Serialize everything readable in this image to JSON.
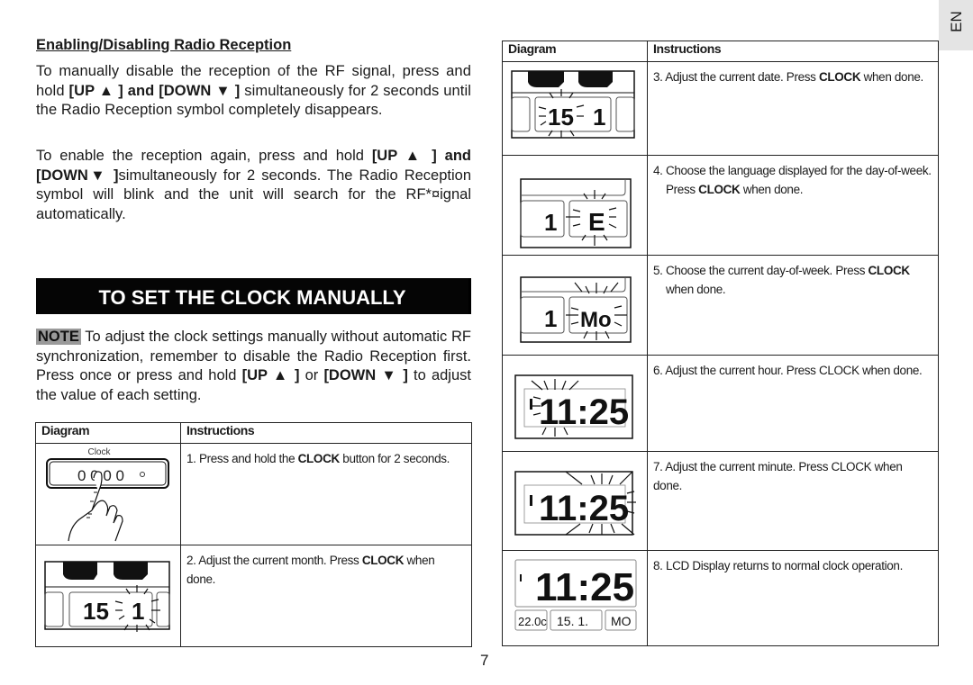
{
  "section1": {
    "heading": "Enabling/Disabling Radio Reception",
    "para1": {
      "t1": "To manually disable the reception of the RF signal, press and hold ",
      "b1": "[UP ▲ ] and [DOWN ▼ ]",
      "t2": " simultaneously for 2 seconds until the Radio Reception symbol completely disappears."
    },
    "para2": {
      "t1": "To enable the reception again, press and hold ",
      "b1": "[UP ▲ ] and [DOWN▼ ]",
      "t2": "simultaneously for 2 seconds. The Radio Reception symbol will blink and the unit will search for the RF*¤ignal automatically."
    }
  },
  "section2": {
    "title": "TO SET THE CLOCK MANUALLY",
    "note_label": "NOTE",
    "note": {
      "t1": " To adjust the clock settings manually without automatic RF synchronization, remember to disable the Radio Reception first. Press once or press and hold ",
      "b1": "[UP ▲ ]",
      "t2": " or ",
      "b2": "[DOWN ▼ ]",
      "t3": " to adjust the value of each setting."
    }
  },
  "table": {
    "col_diagram": "Diagram",
    "col_instructions": "Instructions",
    "steps": [
      {
        "pre": "1. Press and hold the ",
        "bold": "CLOCK",
        "post": " button for 2 seconds.",
        "diagram": "clock-button-press",
        "diagram_label": "Clock",
        "button_digits": "0 0 0 0"
      },
      {
        "pre": "2. Adjust the current month. Press ",
        "bold": "CLOCK",
        "post": " when done.",
        "diagram": "lcd-month-blinking",
        "lcd": "15. 1."
      },
      {
        "pre": "3. Adjust the current date. Press ",
        "bold": "CLOCK",
        "post": " when done.",
        "diagram": "lcd-date-blinking",
        "lcd": "15. 1."
      },
      {
        "pre": "4. Choose the language displayed for the day-of-week. Press ",
        "bold": "CLOCK",
        "post": " when done.",
        "diagram": "lcd-language-blinking",
        "lcd": "1. E"
      },
      {
        "pre": "5. Choose the current day-of-week. Press ",
        "bold": "CLOCK",
        "post": " when done.",
        "diagram": "lcd-weekday-blinking",
        "lcd": "1. Mo"
      },
      {
        "pre": "6. Adjust the current hour. Press CLOCK when done.",
        "bold": "",
        "post": "",
        "diagram": "lcd-hour-blinking",
        "lcd": "11:25"
      },
      {
        "pre": "7. Adjust the current minute. Press CLOCK when done.",
        "bold": "",
        "post": "",
        "diagram": "lcd-minute-blinking",
        "lcd": "11:25"
      },
      {
        "pre": "8. LCD Display returns to normal clock operation.",
        "bold": "",
        "post": "",
        "diagram": "lcd-normal",
        "lcd": "11:25",
        "lcd_sub": [
          "22.0c",
          "15. 1.",
          "MO"
        ]
      }
    ]
  },
  "footer": {
    "page_number": "7",
    "language_tab": "EN"
  }
}
